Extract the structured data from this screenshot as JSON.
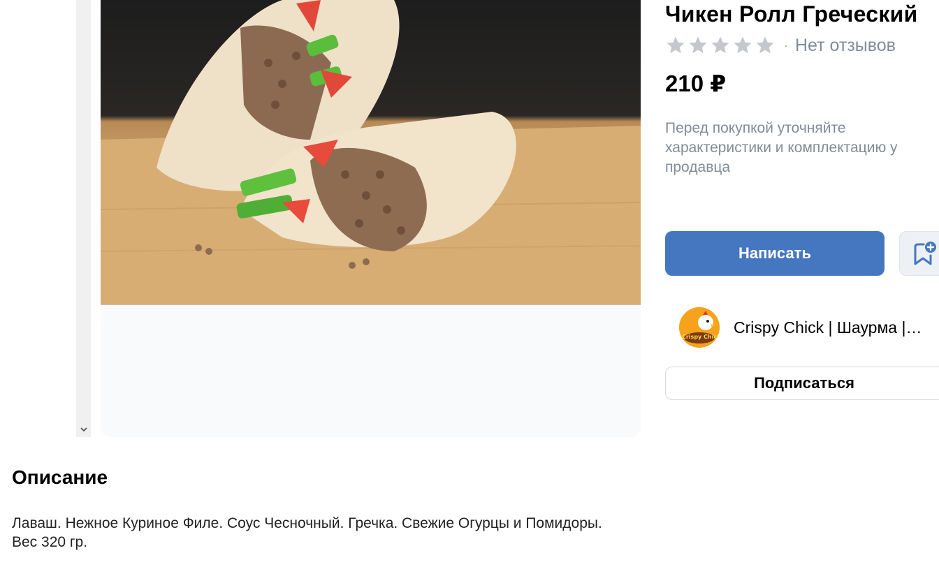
{
  "product": {
    "title": "Чикен Ролл Греческий",
    "rating_stars": 5,
    "rating_filled": 0,
    "reviews_text": "Нет отзывов",
    "price": "210 ₽",
    "note": "Перед покупкой уточняйте характеристики и комплектацию у продавца"
  },
  "actions": {
    "write_label": "Написать",
    "subscribe_label": "Подписаться"
  },
  "seller": {
    "name": "Crispy Chick | Шаурма |…",
    "logo_text": "Crispy Chick"
  },
  "description": {
    "heading": "Описание",
    "line1": "Лаваш. Нежное Куриное Филе. Соус Чесночный. Гречка. Свежие Огурцы и Помидоры.",
    "line2": "Вес 320 гр."
  },
  "colors": {
    "primary_button": "#4477c0",
    "muted_text": "#818c99",
    "star_empty": "#c4c8cc"
  },
  "icons": {
    "scroll_down": "chevron-down-icon",
    "star": "star-icon",
    "bookmark_add": "bookmark-plus-icon"
  }
}
